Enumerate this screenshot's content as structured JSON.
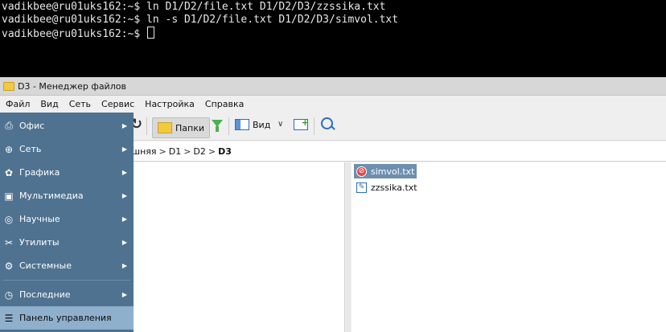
{
  "terminal": {
    "lines": [
      "vadikbee@ru01uks162:~$ ln D1/D2/file.txt D1/D2/D3/zzssika.txt",
      "vadikbee@ru01uks162:~$ ln -s D1/D2/file.txt D1/D2/D3/simvol.txt",
      "vadikbee@ru01uks162:~$ "
    ]
  },
  "window": {
    "title": "D3 - Менеджер файлов"
  },
  "menubar": [
    "Файл",
    "Вид",
    "Сеть",
    "Сервис",
    "Настройка",
    "Справка"
  ],
  "toolbar": {
    "folders_label": "Папки",
    "view_label": "Вид"
  },
  "path": {
    "crumbs": [
      "шняя",
      "D1",
      "D2",
      "D3"
    ],
    "separator": ">"
  },
  "files": [
    {
      "name": "simvol.txt",
      "icon": "symlink-icon",
      "selected": true
    },
    {
      "name": "zzssika.txt",
      "icon": "text-file-icon",
      "selected": false
    }
  ],
  "app_menu": [
    {
      "label": "Офис",
      "icon": "printer-icon",
      "submenu": true
    },
    {
      "label": "Сеть",
      "icon": "globe-icon",
      "submenu": true
    },
    {
      "label": "Графика",
      "icon": "palette-icon",
      "submenu": true
    },
    {
      "label": "Мультимедиа",
      "icon": "play-icon",
      "submenu": true
    },
    {
      "label": "Научные",
      "icon": "science-icon",
      "submenu": true
    },
    {
      "label": "Утилиты",
      "icon": "tools-icon",
      "submenu": true
    },
    {
      "label": "Системные",
      "icon": "gear-icon",
      "submenu": true
    },
    {
      "label": "Последние",
      "icon": "clock-icon",
      "submenu": true
    },
    {
      "label": "Панель управления",
      "icon": "sliders-icon",
      "submenu": false
    }
  ],
  "colors": {
    "menu_bg": "#4f7290",
    "menu_highlight": "#8fb0cc",
    "selection": "#6d8fb0"
  }
}
